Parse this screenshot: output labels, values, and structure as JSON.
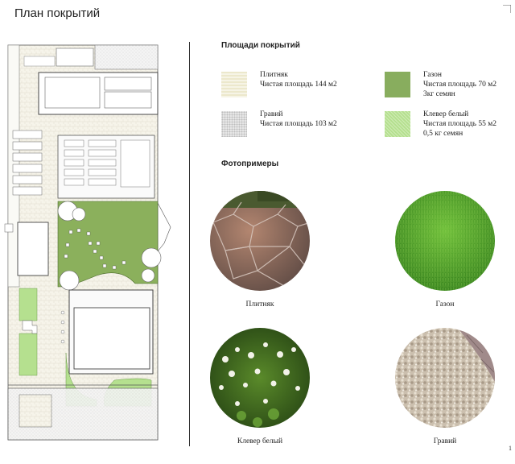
{
  "header": {
    "title": "План покрытий"
  },
  "areas": {
    "title": "Площади покрытий",
    "items": [
      {
        "name": "Плитняк",
        "area": "Чистая площадь 144 м2",
        "note": "",
        "color": "#ece8cc"
      },
      {
        "name": "Газон",
        "area": "Чистая площадь 70 м2",
        "note": "3кг семян",
        "color": "#88ad5e"
      },
      {
        "name": "Гравий",
        "area": "Чистая площадь 103 м2",
        "note": "",
        "color": "#e4e4e4"
      },
      {
        "name": "Клевер белый",
        "area": "Чистая площадь 55 м2",
        "note": "0,5 кг семян",
        "color": "#b5e08f"
      }
    ]
  },
  "photos": {
    "title": "Фотопримеры",
    "items": [
      {
        "caption": "Плитняк",
        "icon": "flagstone-photo"
      },
      {
        "caption": "Газон",
        "icon": "lawn-photo"
      },
      {
        "caption": "Клевер белый",
        "icon": "clover-photo"
      },
      {
        "caption": "Гравий",
        "icon": "gravel-photo"
      }
    ]
  },
  "footer": {
    "page_number": "1"
  },
  "colors": {
    "lawn": "#8bb05c",
    "clover": "#b5e08f",
    "plan_line": "#555555"
  }
}
